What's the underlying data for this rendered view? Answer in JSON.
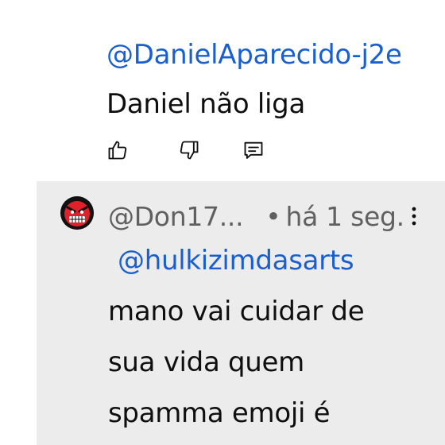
{
  "comment_above": {
    "mention": "@DanielAparecido-j2e",
    "body": " Daniel não liga",
    "actions": {
      "like_icon": "thumbs-up-icon",
      "dislike_icon": "thumbs-down-icon",
      "reply_icon": "reply-icon"
    }
  },
  "comment_highlighted": {
    "author": "@Don17...",
    "separator": "•",
    "timestamp": "há 1 seg.",
    "mention": "@hulkizimdasarts",
    "body_lines": [
      "mano vai cuidar de",
      "sua vida quem",
      "spamma emoji é"
    ],
    "avatar_icon": "angry-red-face-avatar",
    "menu_icon": "more-vertical-icon"
  },
  "colors": {
    "mention": "#1a5fd0",
    "highlight_bg": "#ececec",
    "meta_text": "#606060",
    "text": "#0f0f0f"
  }
}
